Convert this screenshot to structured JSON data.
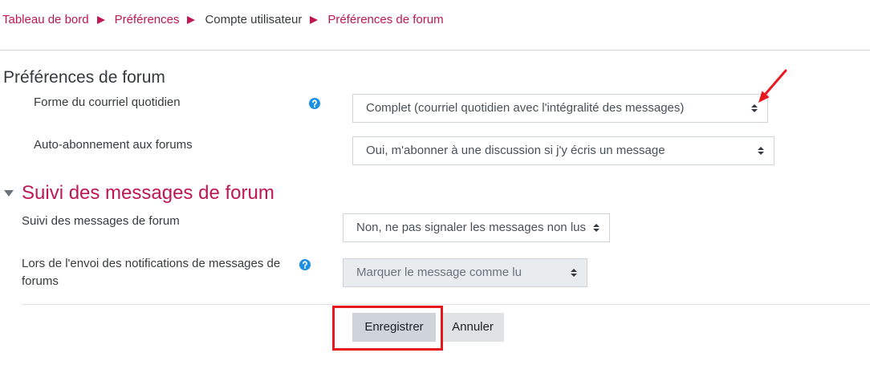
{
  "breadcrumb": {
    "items": [
      {
        "label": "Tableau de bord",
        "is_link": true
      },
      {
        "label": "Préférences",
        "is_link": true
      },
      {
        "label": "Compte utilisateur",
        "is_link": false
      },
      {
        "label": "Préférences de forum",
        "is_link": true
      }
    ],
    "separator_icon": "triangle-right-icon"
  },
  "forum_preferences": {
    "heading": "Préférences de forum",
    "fields": [
      {
        "label": "Forme du courriel quotidien",
        "value": "Complet (courriel quotidien avec l'intégralité des messages)",
        "has_help": true,
        "disabled": false
      },
      {
        "label": "Auto-abonnement aux forums",
        "value": "Oui, m'abonner à une discussion si j'y écris un message",
        "has_help": false,
        "disabled": false
      }
    ]
  },
  "tracking_section": {
    "heading": "Suivi des messages de forum",
    "expanded": true,
    "fields": [
      {
        "label": "Suivi des messages de forum",
        "value": "Non, ne pas signaler les messages non lus",
        "has_help": false,
        "disabled": false
      },
      {
        "label": "Lors de l'envoi des notifications de messages de forums",
        "value": "Marquer le message comme lu",
        "has_help": true,
        "disabled": true
      }
    ]
  },
  "actions": {
    "save_label": "Enregistrer",
    "cancel_label": "Annuler"
  },
  "icons": {
    "help": "question-circle-icon",
    "select_arrow": "sort-arrows-icon",
    "collapse": "caret-down-icon",
    "breadcrumb_separator": "triangle-right-icon"
  },
  "colors": {
    "accent": "#be1752",
    "text": "#373a3c",
    "help_icon": "#1a8fe3",
    "disabled_field": "#e9ecef",
    "button": "#ced4da",
    "annotation": "#e8191e"
  }
}
